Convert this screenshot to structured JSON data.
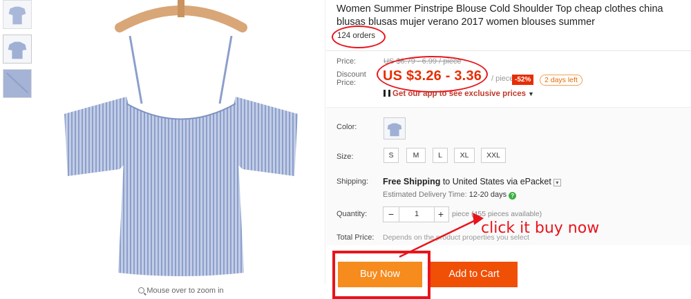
{
  "product": {
    "title": "Women Summer Pinstripe Blouse Cold Shoulder Top cheap clothes china blusas blusas mujer verano 2017 women blouses summer",
    "orders": "124 orders",
    "zoom_hint": "Mouse over to zoom in"
  },
  "price": {
    "price_label": "Price:",
    "original": "US $6.79 - 6.99 / piece",
    "discount_label": "Discount Price:",
    "discount": "US $3.26 - 3.36",
    "per_piece": "/ piece",
    "off_badge": "-52%",
    "days_left": "2 days left",
    "app_link": "Get our app to see exclusive prices"
  },
  "options": {
    "color_label": "Color:",
    "size_label": "Size:",
    "sizes": [
      "S",
      "M",
      "L",
      "XL",
      "XXL"
    ],
    "shipping_label": "Shipping:",
    "shipping_bold": "Free Shipping",
    "shipping_rest": "to United States via ePacket",
    "delivery_label": "Estimated Delivery Time:",
    "delivery_days": "12-20 days",
    "quantity_label": "Quantity:",
    "quantity_minus": "−",
    "quantity_value": "1",
    "quantity_plus": "+",
    "quantity_avail": "piece (455 pieces available)",
    "total_label": "Total Price:",
    "total_text": "Depends on the product properties you select"
  },
  "annotation": {
    "text": "click it buy now",
    "color": "#e8141b"
  },
  "actions": {
    "buy_now": "Buy Now",
    "add_to_cart": "Add to Cart"
  },
  "colors": {
    "accent_red": "#e62e04",
    "buy_orange": "#f68b1e",
    "cart_orange": "#f04f06"
  }
}
